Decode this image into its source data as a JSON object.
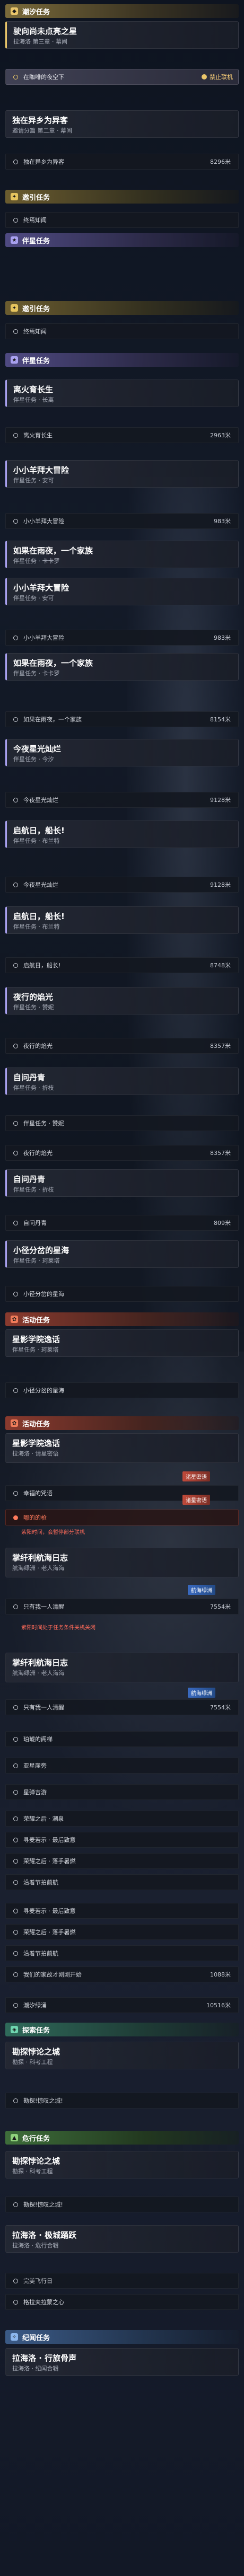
{
  "sections": {
    "tide": "潮汐任务",
    "guide_a": "邀引任务",
    "star_a": "伴星任务",
    "guide_b": "邀引任务",
    "star_b": "伴星任务",
    "event_a": "活动任务",
    "event_b": "活动任务",
    "side": "探索任务",
    "danger": "危行任务",
    "legend": "纪闻任务"
  },
  "quests": {
    "q1": {
      "title": "驶向尚未点亮之星",
      "sub": "拉海洛 第三章 · 幕间"
    },
    "q1_track": {
      "label": "在咖啡的夜空下",
      "forbid": "禁止联机"
    },
    "q2": {
      "title": "独在异乡为异客",
      "sub": "邀请分篇 第二章 · 幕间"
    },
    "q2_obj": {
      "label": "独在异乡为异客",
      "dist": "8296米"
    },
    "q3_obj": {
      "label": "终焉知闻"
    },
    "q4_obj": {
      "label": "终焉知闻"
    },
    "q5": {
      "title": "离火育长生",
      "sub": "伴星任务 · 长离"
    },
    "q5_obj": {
      "label": "离火育长生",
      "dist": "2963米"
    },
    "q6": {
      "title": "小小羊拜大冒险",
      "sub": "伴星任务 · 安可"
    },
    "q6_obj": {
      "label": "小小羊拜大冒险",
      "dist": "983米"
    },
    "q7": {
      "title": "如果在雨夜，一个家族",
      "sub": "伴星任务 · 卡卡罗"
    },
    "q8": {
      "title": "小小羊拜大冒险",
      "sub": "伴星任务 · 安可"
    },
    "q8_obj": {
      "label": "小小羊拜大冒险",
      "dist": "983米"
    },
    "q9": {
      "title": "如果在雨夜，一个家族",
      "sub": "伴星任务 · 卡卡罗"
    },
    "q9_obj": {
      "label": "如果在雨夜，一个家族",
      "dist": "8154米"
    },
    "q10": {
      "title": "今夜星光灿烂",
      "sub": "伴星任务 · 今汐"
    },
    "q10_obj": {
      "label": "今夜星光灿烂",
      "dist": "9128米"
    },
    "q11": {
      "title": "启航日，船长!",
      "sub": "伴星任务 · 布兰特"
    },
    "q11_obj": {
      "label": "今夜星光灿烂",
      "dist": "9128米"
    },
    "q12": {
      "title": "启航日，船长!",
      "sub": "伴星任务 · 布兰特"
    },
    "q12_obj": {
      "label": "启航日，船长!",
      "dist": "8748米"
    },
    "q13": {
      "title": "夜行的焰光",
      "sub": "伴星任务 · 赞妮"
    },
    "q13_obj": {
      "label": "夜行的焰光",
      "dist": "8357米"
    },
    "q14": {
      "title": "自问丹青",
      "sub": "伴星任务 · 折枝"
    },
    "q14_obj": {
      "label": "",
      "sub": "伴星任务 · 赞妮"
    },
    "q14_obj2": {
      "label": "夜行的焰光",
      "dist": "8357米"
    },
    "q15": {
      "title": "自问丹青",
      "sub": "伴星任务 · 折枝"
    },
    "q15_obj": {
      "label": "自问丹青",
      "dist": "809米"
    },
    "q16": {
      "title": "小径分岔的星海",
      "sub": "伴星任务 · 珂莱塔"
    },
    "q16_obj": {
      "label": "小径分岔的星海"
    },
    "q17": {
      "title": "星影学院逸话",
      "sub": "伴星任务 · 珂莱塔"
    },
    "q17_obj": {
      "label": "小径分岔的星海"
    },
    "q18": {
      "title": "星影学院逸话",
      "sub": "拉海洛 · 请星密语"
    },
    "q18_obj1": {
      "label": "幸福的咒语"
    },
    "q18_obj2": {
      "label": "哪的的枪"
    },
    "q18_hint": "紫阳时间，会暂停部分联机",
    "q18_badge": "诸星密语",
    "q18_badge2": "诸星密语",
    "q19": {
      "title": "掌纤利航海日志",
      "sub": "航海绿洲 · 老人海海"
    },
    "q19_obj": {
      "label": "只有我一人清醒",
      "dist": "7554米"
    },
    "q19_badge": "航海绿洲",
    "q19_hint": "紫阳时间处于任务条件关机关闭",
    "q20": {
      "title": "掌纤利航海日志",
      "sub": "航海绿洲 · 老人海海"
    },
    "q20_badge": "航海绿洲",
    "q20_obj1": {
      "label": "只有我一人清醒",
      "dist": "7554米"
    },
    "q20_obj2": {
      "label": "珀琥的阁梯"
    },
    "q20_obj3": {
      "label": "亚星崖旁"
    },
    "q20_obj4": {
      "label": "星弹吉游"
    },
    "q20_obj5": {
      "label": "荣耀之后 · 潮泉"
    },
    "q20_obj6": {
      "label": "寻麦若示 · 最后致意"
    },
    "q20_obj7": {
      "label": "荣耀之后 · 落手暑燃"
    },
    "q20_obj8": {
      "label": "沿着节拍前航"
    },
    "q20_obj9": {
      "label": "寻麦若示 · 最后致意"
    },
    "q20_obj10": {
      "label": "荣耀之后 · 落手暑燃"
    },
    "q20_obj11": {
      "label": "沿着节拍前航"
    },
    "q20_obj12": {
      "label": "我们的家故才刚刚开始",
      "dist": "1088米"
    },
    "q20_obj13": {
      "label": "潮汐绿涌",
      "dist": "10516米"
    },
    "q21": {
      "title": "勘探悖论之城",
      "sub": "勘探 · 科考工程"
    },
    "q21_obj": {
      "label": "勘探!惊叹之城!"
    },
    "q22": {
      "title": "勘探悖论之城",
      "sub": "勘探 · 科考工程"
    },
    "q22_obj1": {
      "label": "勘探!惊叹之城!"
    },
    "q23": {
      "title": "拉海洛 · 极城踊跃",
      "sub": "拉海洛 · 危行合辑"
    },
    "q23_obj1": {
      "label": "完美飞行日"
    },
    "q23_obj2": {
      "label": "格拉夫拉蒙之心"
    },
    "q24": {
      "title": "拉海洛 · 行旅骨声",
      "sub": "拉海洛 · 纪闻合辑"
    }
  },
  "colors": {
    "tide": "#e9c56a",
    "star": "#a9a1f0",
    "event": "#f07c5a",
    "side": "#6fd6b0",
    "danger": "#8fd27c",
    "legend": "#8bb6ee",
    "warning_text": "#ff7a5c"
  },
  "icons": {
    "category": "square-badge-icon",
    "objective": "ring-icon",
    "collapse": "chevron-up-icon"
  }
}
